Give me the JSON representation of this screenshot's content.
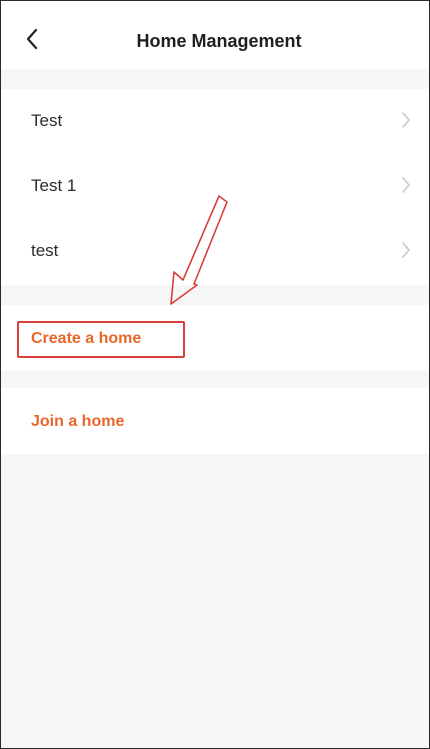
{
  "header": {
    "title": "Home Management",
    "back_icon": "chevron-left-icon"
  },
  "homes": [
    {
      "label": "Test",
      "chevron_icon": "chevron-right-icon"
    },
    {
      "label": "Test 1",
      "chevron_icon": "chevron-right-icon"
    },
    {
      "label": "test",
      "chevron_icon": "chevron-right-icon"
    }
  ],
  "actions": {
    "create_label": "Create a home",
    "join_label": "Join a home"
  },
  "colors": {
    "accent": "#e8672a",
    "annotation": "#d9403b",
    "background": "#f6f6f6",
    "surface": "#ffffff"
  }
}
